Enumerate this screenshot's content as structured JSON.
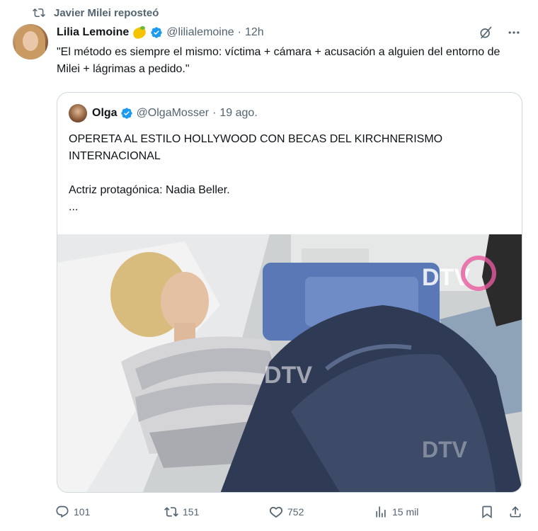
{
  "repost": {
    "text": "Javier Milei reposteó",
    "icon": "repost-icon"
  },
  "tweet": {
    "author": {
      "display_name": "Lilia Lemoine",
      "emoji": "lemon-emoji",
      "verified": true,
      "handle": "@lilialemoine",
      "separator": "·",
      "time": "12h"
    },
    "text": "\"El método es siempre el mismo: víctima + cámara + acusación a alguien del entorno de Milei + lágrimas a pedido.\"",
    "menu_icons": [
      "grok-icon",
      "more-icon"
    ]
  },
  "quoted_tweet": {
    "author": {
      "display_name": "Olga",
      "verified": true,
      "handle": "@OlgaMosser",
      "separator": "·",
      "date": "19 ago."
    },
    "lines": [
      "OPERETA AL ESTILO HOLLYWOOD CON BECAS DEL KIRCHNERISMO INTERNACIONAL",
      "Actriz protagónica: Nadia Beller.",
      "..."
    ],
    "image": {
      "watermark": "DTV",
      "description_icon": "photo"
    }
  },
  "actions": {
    "replies": "101",
    "reposts": "151",
    "likes": "752",
    "views": "15 mil"
  },
  "colors": {
    "secondary_text": "#536471",
    "verified": "#1d9bf0",
    "border": "#cfd9de",
    "text": "#0f1419"
  }
}
